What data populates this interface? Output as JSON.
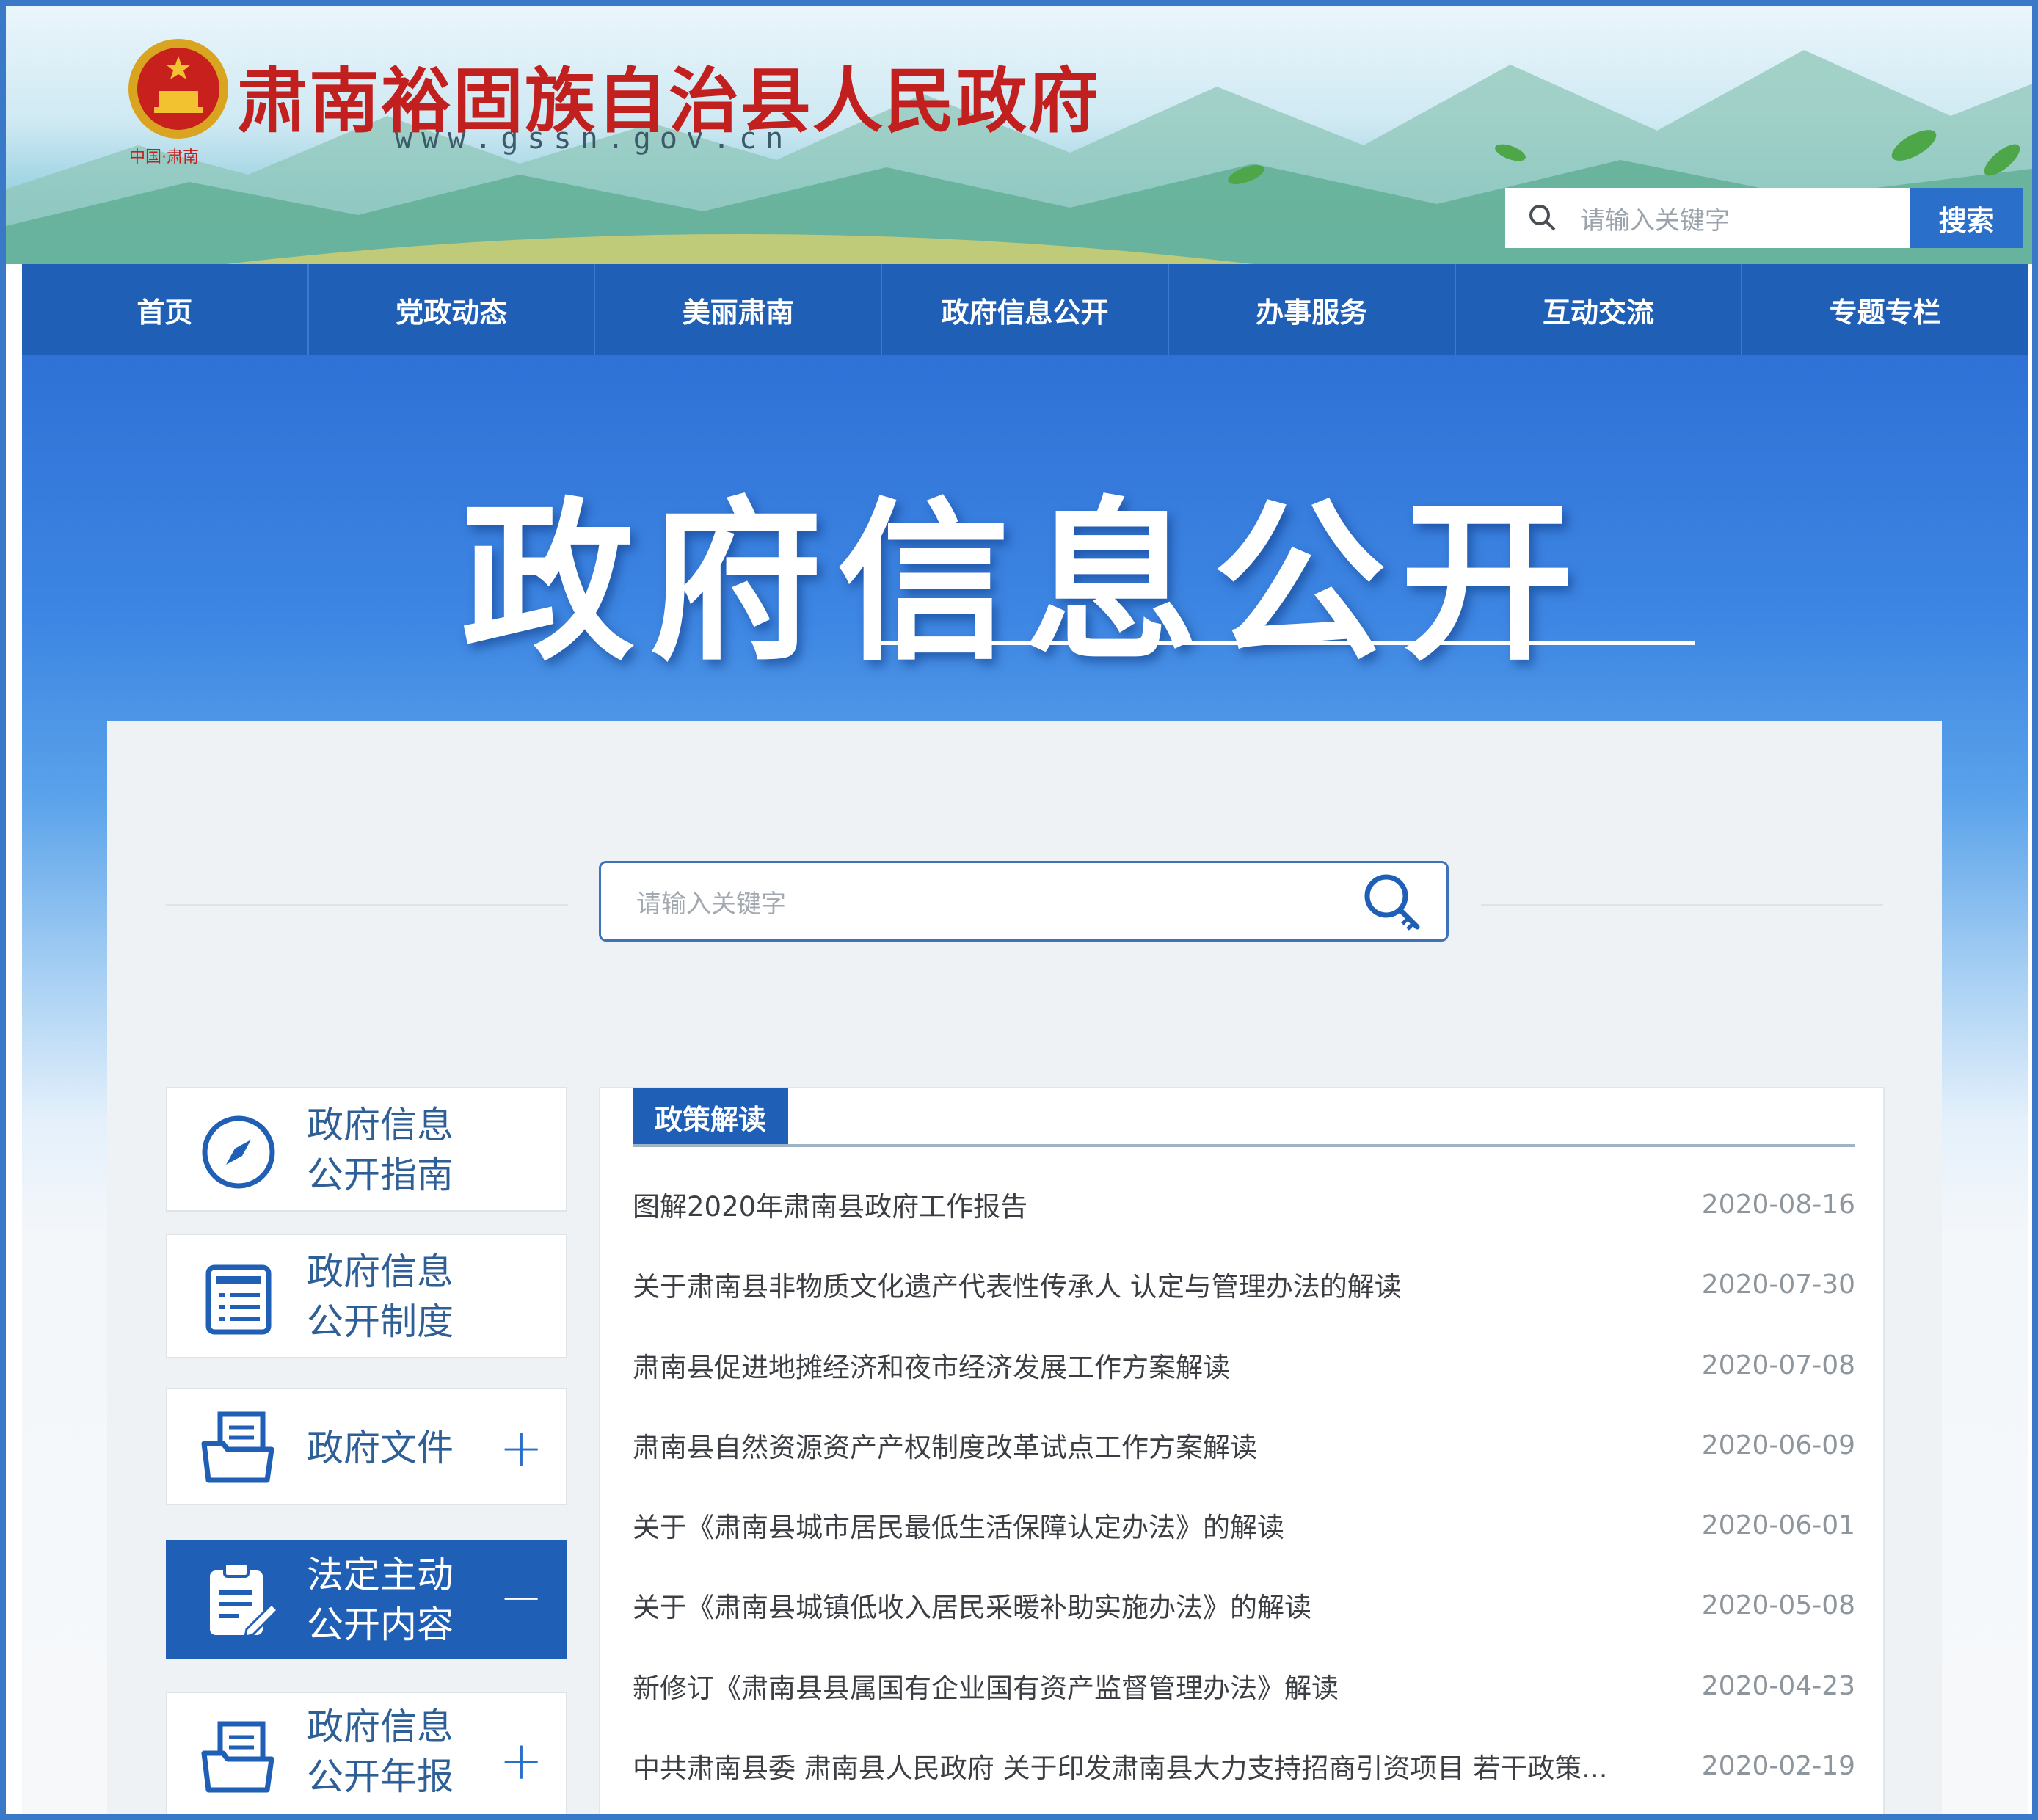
{
  "header": {
    "site_title": "肃南裕固族自治县人民政府",
    "site_url": "www.gssn.gov.cn",
    "emblem_label": "中国·肃南",
    "search_placeholder": "请输入关键字",
    "search_button": "搜索",
    "emblem_icon": "national-emblem-icon"
  },
  "nav": {
    "items": [
      "首页",
      "党政动态",
      "美丽肃南",
      "政府信息公开",
      "办事服务",
      "互动交流",
      "专题专栏"
    ]
  },
  "banner": {
    "title": "政府信息公开"
  },
  "main_search": {
    "placeholder": "请输入关键字",
    "icon": "search-key-icon"
  },
  "sidebar": {
    "items": [
      {
        "line1": "政府信息",
        "line2": "公开指南",
        "icon": "compass-icon",
        "toggle": ""
      },
      {
        "line1": "政府信息",
        "line2": "公开制度",
        "icon": "list-icon",
        "toggle": ""
      },
      {
        "line1": "政府文件",
        "line2": "",
        "icon": "folder-document-icon",
        "toggle": "+"
      },
      {
        "line1": "法定主动",
        "line2": "公开内容",
        "icon": "clipboard-edit-icon",
        "toggle": "−",
        "active": true
      },
      {
        "line1": "政府信息",
        "line2": "公开年报",
        "icon": "folder-document-icon",
        "toggle": "+"
      }
    ]
  },
  "news": {
    "tab": "政策解读",
    "items": [
      {
        "title": "图解2020年肃南县政府工作报告",
        "date": "2020-08-16"
      },
      {
        "title": "关于肃南县非物质文化遗产代表性传承人 认定与管理办法的解读",
        "date": "2020-07-30"
      },
      {
        "title": "肃南县促进地摊经济和夜市经济发展工作方案解读",
        "date": "2020-07-08"
      },
      {
        "title": "肃南县自然资源资产产权制度改革试点工作方案解读",
        "date": "2020-06-09"
      },
      {
        "title": "关于《肃南县城市居民最低生活保障认定办法》的解读",
        "date": "2020-06-01"
      },
      {
        "title": "关于《肃南县城镇低收入居民采暖补助实施办法》的解读",
        "date": "2020-05-08"
      },
      {
        "title": "新修订《肃南县县属国有企业国有资产监督管理办法》解读",
        "date": "2020-04-23"
      },
      {
        "title": "中共肃南县委 肃南县人民政府 关于印发肃南县大力支持招商引资项目 若干政策...",
        "date": "2020-02-19"
      }
    ]
  },
  "colors": {
    "primary_blue": "#1f5fb5",
    "title_red": "#c21f1f",
    "accent_blue": "#2a6fc9"
  }
}
